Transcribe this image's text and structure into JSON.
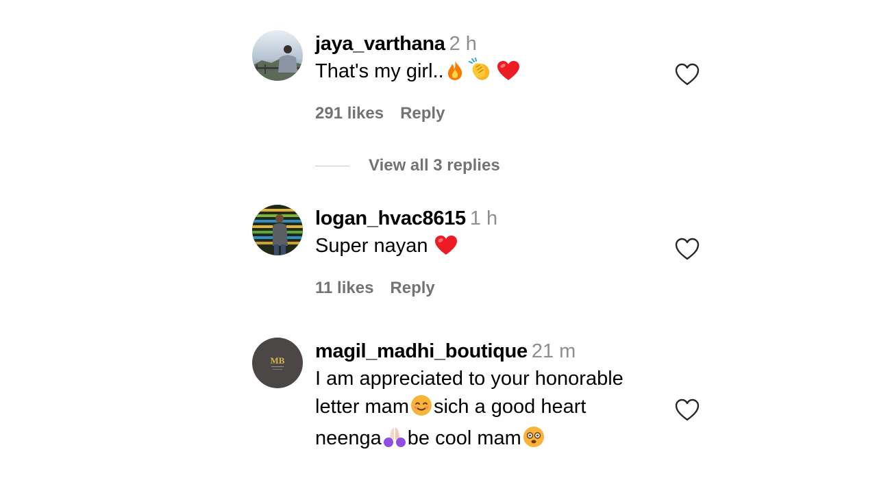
{
  "comments": [
    {
      "username": "jaya_varthana",
      "time": "2 h",
      "text": "That's my girl..",
      "emojis": [
        "fire",
        "clapping-hands",
        "red-heart"
      ],
      "likes": "291 likes",
      "reply": "Reply"
    },
    {
      "username": "logan_hvac8615",
      "time": "1 h",
      "text": "Super nayan",
      "emojis": [
        "red-heart"
      ],
      "likes": "11 likes",
      "reply": "Reply"
    },
    {
      "username": "magil_madhi_boutique",
      "time": "21 m",
      "lines": [
        "I am appreciated to your honorable",
        "letter mam",
        "sich a good heart",
        "neenga",
        "be cool mam"
      ],
      "emojis": [
        "smiling-face",
        "folded-hands",
        "face-with-spiral-eyes"
      ]
    }
  ],
  "view_replies": "View all 3 replies",
  "avatar3_logo": "MB",
  "colors": {
    "muted": "#737373",
    "time": "#8e8e8e",
    "heart": "#ed1c24"
  }
}
